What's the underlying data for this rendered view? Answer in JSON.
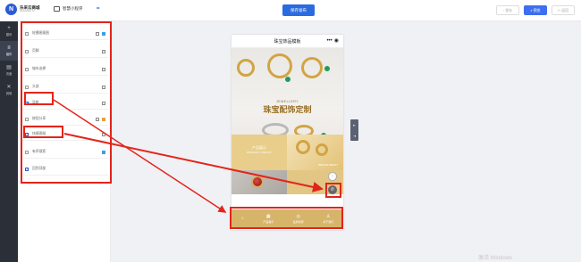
{
  "brand": {
    "logo_letter": "N",
    "name": "乐采云商城",
    "sub": "ShopWeb AI"
  },
  "app_type": "智慧小程序",
  "publish": "保存发布",
  "top_buttons": [
    {
      "label": "保存"
    },
    {
      "label": "预览"
    },
    {
      "label": "返回"
    }
  ],
  "rail": [
    {
      "label": "模块",
      "glyph": "+"
    },
    {
      "label": "组件",
      "glyph": "≡"
    },
    {
      "label": "页面",
      "glyph": "▤"
    },
    {
      "label": "其他",
      "glyph": "✕"
    }
  ],
  "components": [
    {
      "label": "轮播图插图",
      "checked": false,
      "icon": "blue"
    },
    {
      "label": "页脚",
      "checked": false,
      "icon": "plain"
    },
    {
      "label": "城市选择",
      "checked": false,
      "icon": "plain"
    },
    {
      "label": "头部",
      "checked": false,
      "icon": "plain"
    },
    {
      "label": "导航",
      "checked": true,
      "icon": "plain"
    },
    {
      "label": "按钮分享",
      "checked": false,
      "icon": "orange"
    },
    {
      "label": "快捷客服",
      "checked": true,
      "icon": "plain"
    },
    {
      "label": "有序搜索",
      "checked": false,
      "icon": "blue"
    },
    {
      "label": "回到顶部",
      "checked": true,
      "icon": "none"
    }
  ],
  "phone": {
    "title": "珠宝饰品模板",
    "cap_icons": [
      "•••",
      "◉"
    ],
    "hero_en": "JEWELLERY",
    "hero_cn": "珠宝配饰定制",
    "gold_title": "产品展示",
    "gold_sub": "PRODUCT DISPLAY",
    "gold_img_label": "BRAND ABOUT"
  },
  "bottom_nav": [
    {
      "label": "",
      "glyph": "⌂"
    },
    {
      "label": "产品展示",
      "glyph": "▦"
    },
    {
      "label": "品牌优势",
      "glyph": "◎"
    },
    {
      "label": "关于我们",
      "glyph": "♙"
    }
  ],
  "fabs": [
    "↑",
    "✆"
  ],
  "side_tool": [
    "⇤",
    "⇥"
  ],
  "watermark": "激活 Windows"
}
